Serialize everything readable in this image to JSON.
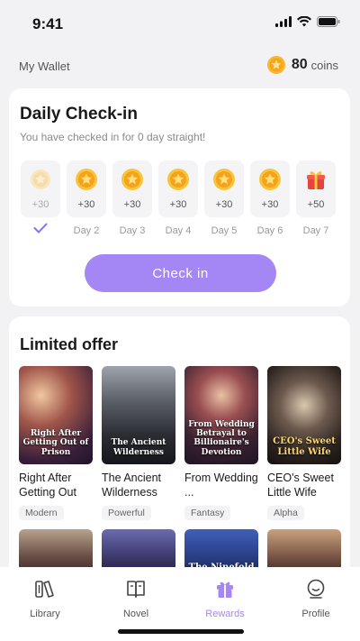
{
  "status_bar": {
    "time": "9:41"
  },
  "wallet": {
    "label": "My Wallet",
    "coins": "80",
    "unit": "coins"
  },
  "checkin": {
    "title": "Daily Check-in",
    "subtitle": "You have checked in for 0 day straight!",
    "days": [
      {
        "value": "+30",
        "label": "",
        "state": "checked"
      },
      {
        "value": "+30",
        "label": "Day 2"
      },
      {
        "value": "+30",
        "label": "Day 3"
      },
      {
        "value": "+30",
        "label": "Day 4"
      },
      {
        "value": "+30",
        "label": "Day 5"
      },
      {
        "value": "+30",
        "label": "Day 6"
      },
      {
        "value": "+50",
        "label": "Day 7"
      }
    ],
    "button": "Check in"
  },
  "offer": {
    "title": "Limited offer",
    "books": [
      {
        "title": "Right After Getting Out",
        "tag": "Modern",
        "cover_text": "Right After Getting Out of Prison"
      },
      {
        "title": "The Ancient Wilderness",
        "tag": "Powerful",
        "cover_text": "The Ancient Wilderness"
      },
      {
        "title": "From Wedding ...",
        "tag": "Fantasy",
        "cover_text": "From Wedding Betrayal to Billionaire's Devotion"
      },
      {
        "title": "CEO's Sweet Little Wife",
        "tag": "Alpha",
        "cover_text": "CEO's Sweet Little Wife"
      }
    ],
    "next_row_cover_text": [
      "",
      "",
      "The Ninefold",
      ""
    ]
  },
  "tabs": [
    {
      "label": "Library",
      "icon": "library-icon"
    },
    {
      "label": "Novel",
      "icon": "novel-icon"
    },
    {
      "label": "Rewards",
      "icon": "rewards-icon",
      "active": true
    },
    {
      "label": "Profile",
      "icon": "profile-icon"
    }
  ],
  "colors": {
    "accent": "#a586f5",
    "coin": "#f5a623",
    "background": "#f2f2f5"
  }
}
